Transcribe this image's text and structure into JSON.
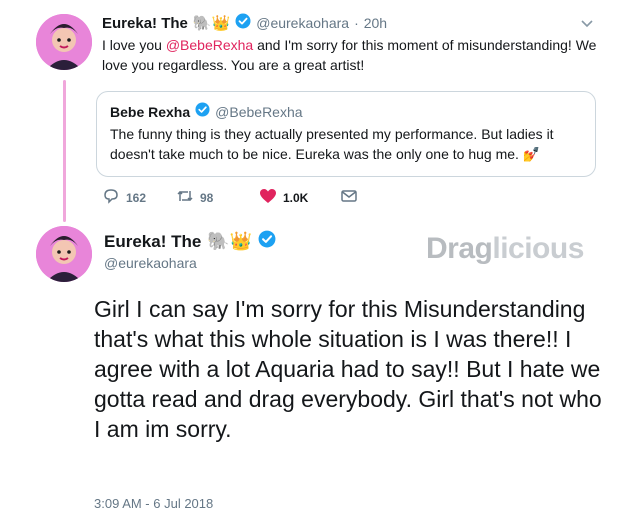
{
  "reply_tweet": {
    "display_name": "Eureka! The",
    "emoji": "🐘👑",
    "handle": "@eurekaohara",
    "separator": "·",
    "time": "20h",
    "text_before": "I love you ",
    "mention": "@BebeRexha",
    "text_after": " and I'm sorry for this moment of misunderstanding! We love you regardless. You are a great artist!"
  },
  "quoted_tweet": {
    "display_name": "Bebe Rexha",
    "handle": "@BebeRexha",
    "text": "The funny thing is they actually presented my performance. But ladies it doesn't take much to be nice. Eureka was the only one to hug me. 💅"
  },
  "actions": {
    "reply_count": "162",
    "retweet_count": "98",
    "like_count": "1.0K"
  },
  "main_tweet": {
    "display_name": "Eureka! The",
    "emoji": "🐘👑",
    "handle": "@eurekaohara",
    "text": "Girl I can say I'm sorry for this Misunderstanding that's what this whole situation is I was there!! I agree with a lot Aquaria had to say!! But I hate we gotta read and drag everybody. Girl that's not who I am im sorry.",
    "timestamp": "3:09 AM - 6 Jul 2018"
  },
  "watermark": {
    "part1": "Drag",
    "part2": "licious"
  },
  "colors": {
    "accent_pink": "#e0245e",
    "verified_blue": "#1da1f2",
    "muted": "#657786",
    "thread_line": "#f0a7db"
  },
  "icons": [
    "reply-icon",
    "retweet-icon",
    "heart-icon",
    "message-icon",
    "chevron-down-icon",
    "verified-badge-icon"
  ]
}
